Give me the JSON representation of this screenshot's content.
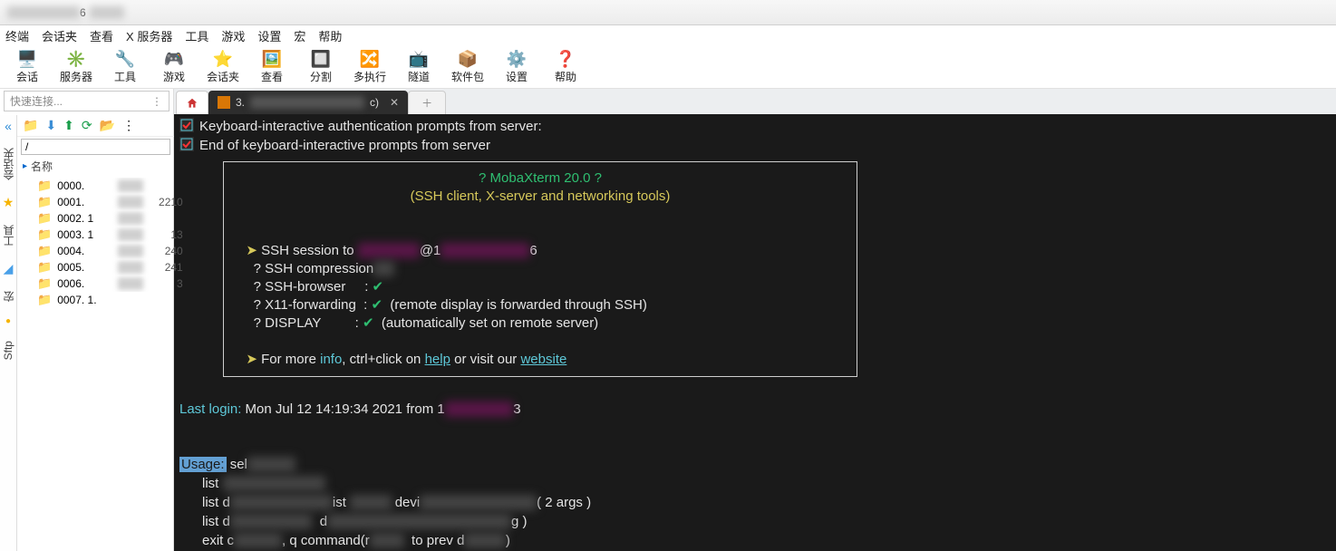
{
  "titlebar": {
    "prefix": "█████████",
    "mid": "6",
    "suffix": "███c)"
  },
  "menu": [
    "终端",
    "会话夹",
    "查看",
    "X 服务器",
    "工具",
    "游戏",
    "设置",
    "宏",
    "帮助"
  ],
  "toolbar": [
    {
      "icon": "🖥️",
      "label": "会话"
    },
    {
      "icon": "✳️",
      "label": "服务器"
    },
    {
      "icon": "🔧",
      "label": "工具"
    },
    {
      "icon": "🎮",
      "label": "游戏"
    },
    {
      "icon": "⭐",
      "label": "会话夹"
    },
    {
      "icon": "🖼️",
      "label": "查看"
    },
    {
      "icon": "🔲",
      "label": "分割"
    },
    {
      "icon": "🔀",
      "label": "多执行"
    },
    {
      "icon": "📺",
      "label": "隧道"
    },
    {
      "icon": "📦",
      "label": "软件包"
    },
    {
      "icon": "⚙️",
      "label": "设置"
    },
    {
      "icon": "❓",
      "label": "帮助"
    }
  ],
  "quick": {
    "placeholder": "快速连接..."
  },
  "sidetabs": {
    "chev": "«",
    "star": "★",
    "jiahua": "会话夹",
    "tools": "工具",
    "macro": "宏",
    "sftp": "Sftp"
  },
  "fpath": "/",
  "header_name": "名称",
  "files": [
    {
      "name": "0000.",
      "s": ""
    },
    {
      "name": "0001.",
      "s": "2210"
    },
    {
      "name": "0002. 1",
      "s": ""
    },
    {
      "name": "0003. 1",
      "s": "13"
    },
    {
      "name": "0004.",
      "s": "240"
    },
    {
      "name": "0005.",
      "s": "241"
    },
    {
      "name": "0006.",
      "s": "3"
    },
    {
      "name": "0007. 1.",
      "s": ""
    }
  ],
  "tabs": {
    "active_prefix": "3.",
    "active_suffix": "c)",
    "new": "+"
  },
  "term": {
    "l1": "Keyboard-interactive authentication prompts from server:",
    "l2": "End of keyboard-interactive prompts from server",
    "box_title": "? MobaXterm 20.0 ?",
    "box_sub": "(SSH client, X-server and networking tools)",
    "ssh_to_pre": "SSH session to ",
    "ssh_at": "@1",
    "ssh_tail": "6",
    "comp": "? SSH compression",
    "brow": "? SSH-browser     : ",
    "x11": "? X11-forwarding  : ",
    "x11_note": "  (remote display is forwarded through SSH)",
    "disp": "? DISPLAY         : ",
    "disp_note": "  (automatically set on remote server)",
    "more_pre": "For more ",
    "info": "info",
    "more_mid": ", ctrl+click on ",
    "help": "help",
    "more_mid2": " or visit our ",
    "website": "website",
    "last_login_l": "Last login:",
    "last_login_r": " Mon Jul 12 14:19:34 2021 from 1",
    "last_login_t": "3",
    "usage": "Usage:",
    "u1": " sel",
    "u2": "      list ",
    "u3a": "      list d",
    "u3b": "ist ",
    "u3c": " devi",
    "u3d": "( 2 args )",
    "u4a": "      list d",
    "u4b": "  d",
    "u4c": "g )",
    "u5a": "      exit c",
    "u5b": ", q command(r",
    "u5c": "  to prev d",
    "u5d": ")"
  }
}
